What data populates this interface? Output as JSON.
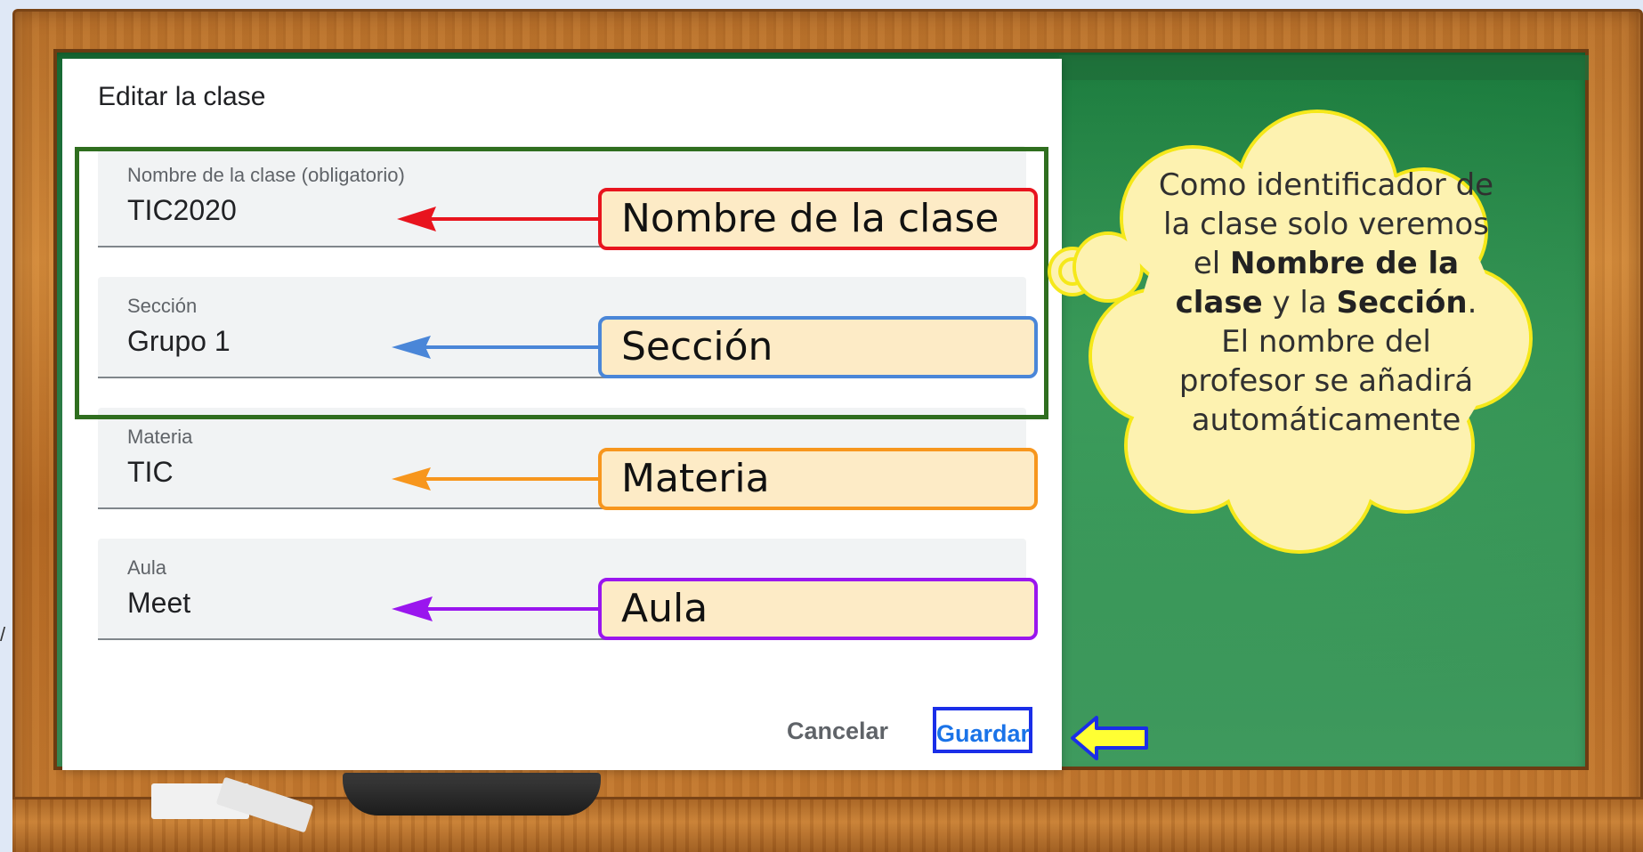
{
  "dialog": {
    "title": "Editar la clase",
    "fields": [
      {
        "label": "Nombre de la clase (obligatorio)",
        "value": "TIC2020"
      },
      {
        "label": "Sección",
        "value": "Grupo 1"
      },
      {
        "label": "Materia",
        "value": "TIC"
      },
      {
        "label": "Aula",
        "value": "Meet"
      }
    ],
    "cancel_label": "Cancelar",
    "save_label": "Guardar"
  },
  "annotations": {
    "callouts": [
      {
        "text": "Nombre de la clase",
        "color": "#e8141e"
      },
      {
        "text": "Sección",
        "color": "#4a86d8"
      },
      {
        "text": "Materia",
        "color": "#f7961d"
      },
      {
        "text": "Aula",
        "color": "#9a16ee"
      }
    ],
    "group_box_color": "#2f6e1f",
    "save_pointer_color": "#ffff33"
  },
  "cloud": {
    "line1": "Como identificador de la clase solo veremos el",
    "bold1": "Nombre de la clase",
    "mid": " y la ",
    "bold2": "Sección",
    "end": ".",
    "line2": "El nombre del profesor se añadirá automáticamente",
    "fill_color": "#fdf2b0",
    "stroke_color": "#f5e81a"
  },
  "decor": {
    "stray_mark": "/"
  }
}
